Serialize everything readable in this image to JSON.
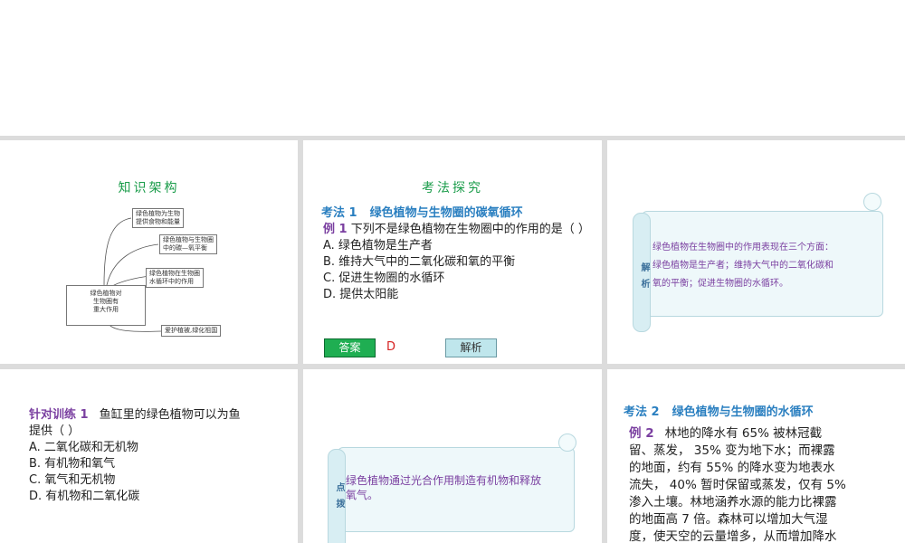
{
  "slide1": {
    "title": "知识架构",
    "mindmap": {
      "center": "绿色植物对生物圈有重大作用",
      "center_lines": [
        "绿色植物对",
        "生物圈有",
        "重大作用"
      ],
      "b1": [
        "绿色植物为生物",
        "提供食物和能量"
      ],
      "b2": [
        "绿色植物与生物圈",
        "中的碳—氧平衡"
      ],
      "b3": [
        "绿色植物在生物圈",
        "水循环中的作用"
      ],
      "b4": [
        "爱护植被,绿化祖国"
      ]
    }
  },
  "slide2": {
    "title": "考法探究",
    "section_num": "考法 1",
    "section_title": "绿色植物与生物圈的碳氧循环",
    "example_label": "例 1",
    "question": "下列不是绿色植物在生物圈中的作用的是（          ）",
    "options": [
      "A. 绿色植物是生产者",
      "B. 维持大气中的二氧化碳和氧的平衡",
      "C. 促进生物圈的水循环",
      "D. 提供太阳能"
    ],
    "answer_button": "答案",
    "answer_value": "D",
    "explain_button": "解析"
  },
  "slide3": {
    "tag": "解析",
    "lines": [
      "绿色植物在生物圈中的作用表现在三个方面：",
      "绿色植物是生产者；维持大气中的二氧化碳和",
      "氧的平衡；促进生物圈的水循环。"
    ]
  },
  "slide4": {
    "label": "针对训练 1",
    "question_l1": "鱼缸里的绿色植物可以为鱼",
    "question_l2": "提供（          ）",
    "options": [
      "A. 二氧化碳和无机物",
      "B. 有机物和氧气",
      "C. 氧气和无机物",
      "D. 有机物和二氧化碳"
    ]
  },
  "slide5": {
    "tag": "点拨",
    "lines": [
      "绿色植物通过光合作用制造有机物和释放",
      "氧气。"
    ]
  },
  "slide6": {
    "section_num": "考法 2",
    "section_title": "绿色植物与生物圈的水循环",
    "example_label": "例 2",
    "lines": [
      "林地的降水有 65% 被林冠截",
      "留、蒸发， 35% 变为地下水；而裸露",
      "的地面，约有 55% 的降水变为地表水",
      "流失， 40% 暂时保留或蒸发，仅有 5%",
      "渗入土壤。林地涵养水源的能力比裸露",
      "的地面高 7 倍。森林可以增加大气湿",
      "度，使天空的云量增多，从而增加降水"
    ]
  },
  "colors": {
    "title_green": "#1a9c4a",
    "section_blue": "#2a7fc0",
    "label_purple": "#7a3fa0",
    "answer_red": "#d62020"
  }
}
